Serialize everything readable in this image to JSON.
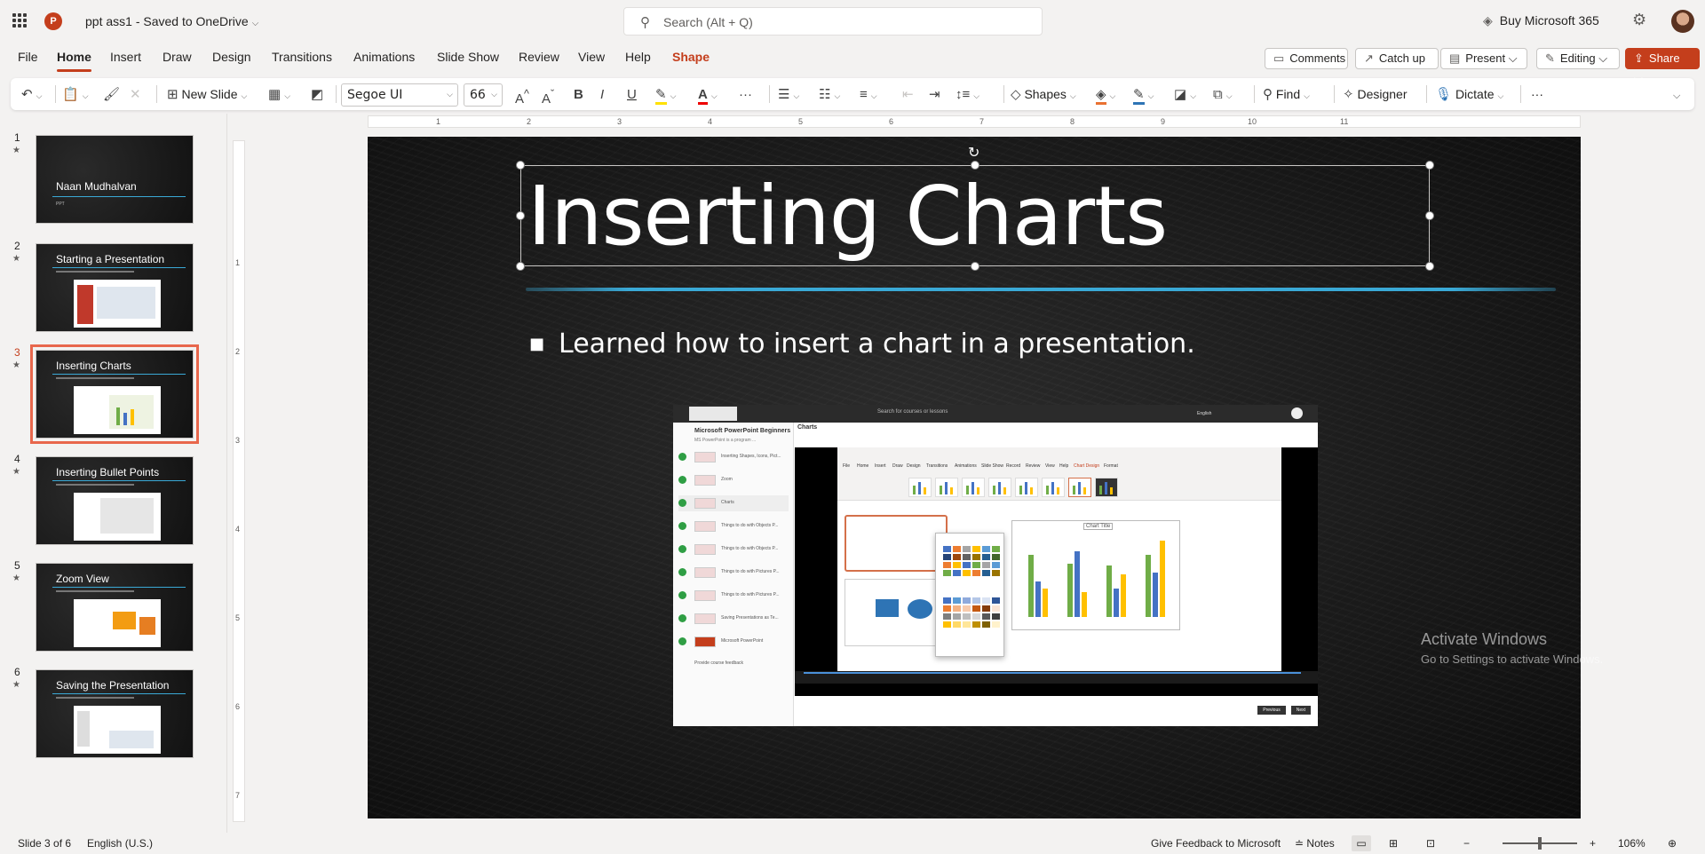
{
  "titlebar": {
    "doc_name": "ppt ass1",
    "save_status": "Saved to OneDrive",
    "search_placeholder": "Search (Alt + Q)",
    "buy_label": "Buy Microsoft 365"
  },
  "menu": {
    "tabs": [
      "File",
      "Home",
      "Insert",
      "Draw",
      "Design",
      "Transitions",
      "Animations",
      "Slide Show",
      "Review",
      "View",
      "Help",
      "Shape"
    ],
    "active": "Home"
  },
  "top_buttons": {
    "comments": "Comments",
    "catch_up": "Catch up",
    "present": "Present",
    "editing": "Editing",
    "share": "Share"
  },
  "ribbon": {
    "new_slide": "New Slide",
    "font_name": "Segoe UI",
    "font_size": "66",
    "shapes": "Shapes",
    "find": "Find",
    "designer": "Designer",
    "dictate": "Dictate",
    "more": "···"
  },
  "slides": [
    {
      "num": "1",
      "title": "Naan Mudhalvan",
      "sub": "PPT"
    },
    {
      "num": "2",
      "title": "Starting a Presentation"
    },
    {
      "num": "3",
      "title": "Inserting Charts",
      "selected": true
    },
    {
      "num": "4",
      "title": "Inserting Bullet Points"
    },
    {
      "num": "5",
      "title": "Zoom View"
    },
    {
      "num": "6",
      "title": "Saving the Presentation"
    }
  ],
  "slide": {
    "title": "Inserting Charts",
    "bullet": "Learned how to insert a chart in a presentation."
  },
  "embedded": {
    "course_title": "Microsoft PowerPoint Beginners",
    "course_sub": "MS PowerPoint is a program ...",
    "header": "Charts",
    "search": "Search for courses or lessons",
    "lang": "English",
    "lessons": [
      "Inserting Shapes, Icons, Pict...",
      "Zoom",
      "Charts",
      "Things to do with Objects P...",
      "Things to do with Objects P...",
      "Things to do with Pictures P...",
      "Things to do with Pictures P...",
      "Saving Presentations as Te...",
      "Microsoft PowerPoint"
    ],
    "feedback": "Provide course feedback",
    "chart_title": "Chart Title",
    "prev": "Previous",
    "next": "Next",
    "app_tabs": [
      "File",
      "Home",
      "Insert",
      "Draw",
      "Design",
      "Transitions",
      "Animations",
      "Slide Show",
      "Record",
      "Review",
      "View",
      "Help",
      "Chart Design",
      "Format"
    ]
  },
  "watermark": {
    "line1": "Activate Windows",
    "line2": "Go to Settings to activate Windows."
  },
  "status": {
    "slide_pos": "Slide 3 of 6",
    "language": "English (U.S.)",
    "feedback": "Give Feedback to Microsoft",
    "notes": "Notes",
    "zoom": "106%",
    "zoom_level": 0.5
  },
  "ruler": {
    "h": [
      "1",
      "2",
      "3",
      "4",
      "5",
      "6",
      "7",
      "8",
      "9",
      "10",
      "11"
    ],
    "v": [
      "1",
      "2",
      "3",
      "4",
      "5",
      "6",
      "7"
    ]
  },
  "colors": {
    "accent": "#c43e1c",
    "chalk_line": "#3aa9d6"
  }
}
